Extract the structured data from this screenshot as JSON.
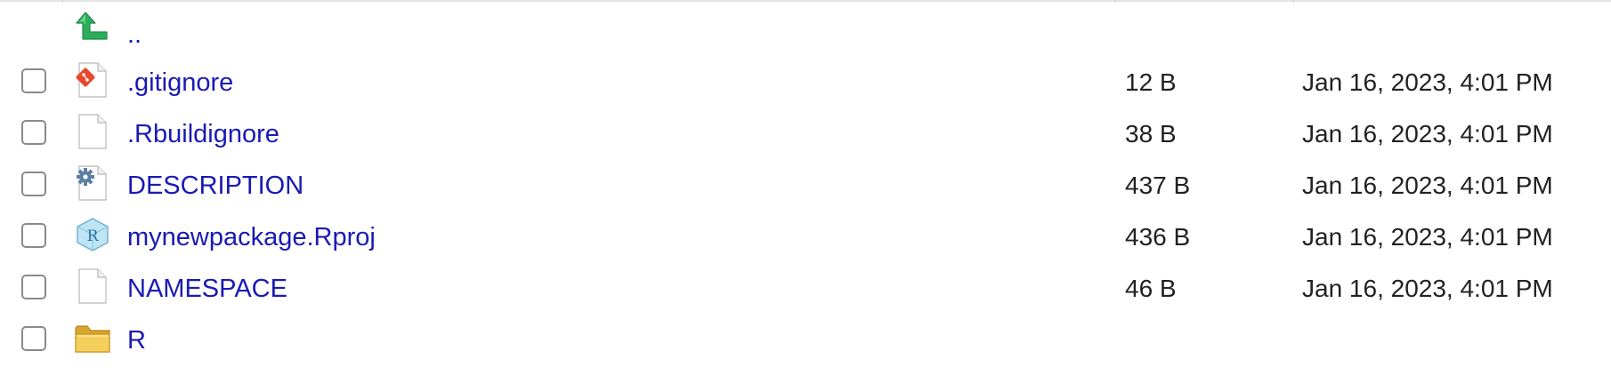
{
  "files": {
    "parent": {
      "name": "..",
      "icon": "up-arrow-icon"
    },
    "rows": [
      {
        "name": ".gitignore",
        "icon": "git-file-icon",
        "size": "12 B",
        "modified": "Jan 16, 2023, 4:01 PM"
      },
      {
        "name": ".Rbuildignore",
        "icon": "blank-file-icon",
        "size": "38 B",
        "modified": "Jan 16, 2023, 4:01 PM"
      },
      {
        "name": "DESCRIPTION",
        "icon": "config-file-icon",
        "size": "437 B",
        "modified": "Jan 16, 2023, 4:01 PM"
      },
      {
        "name": "mynewpackage.Rproj",
        "icon": "rproject-icon",
        "size": "436 B",
        "modified": "Jan 16, 2023, 4:01 PM"
      },
      {
        "name": "NAMESPACE",
        "icon": "blank-file-icon",
        "size": "46 B",
        "modified": "Jan 16, 2023, 4:01 PM"
      },
      {
        "name": "R",
        "icon": "folder-icon",
        "size": "",
        "modified": ""
      }
    ]
  },
  "colors": {
    "link": "#1a1ab5",
    "text": "#222222",
    "up_arrow": "#2cae5a",
    "git": "#e8472a",
    "folder": "#f0c44c"
  }
}
